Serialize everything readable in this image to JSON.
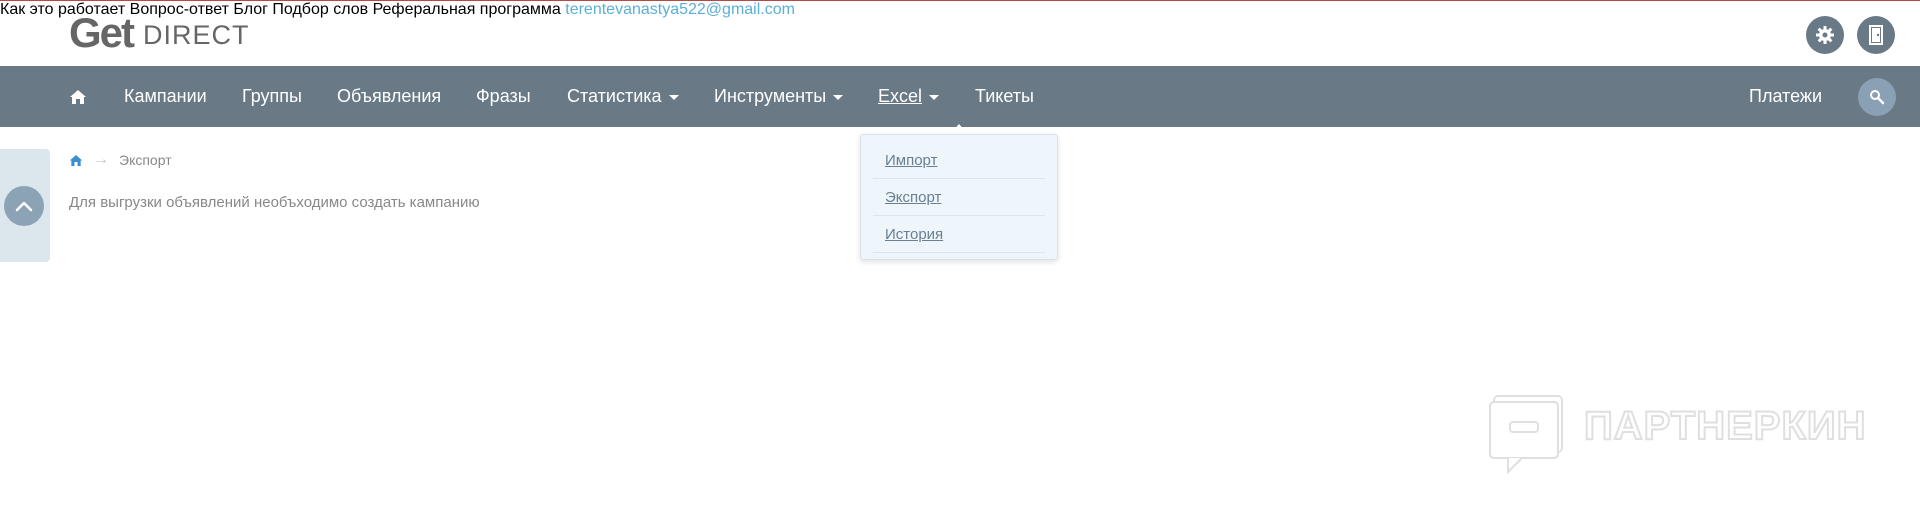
{
  "header": {
    "logo_get": "Get",
    "logo_direct": "DIRECT",
    "links": [
      "Как это работает",
      "Вопрос-ответ",
      "Блог",
      "Подбор слов",
      "Реферальная программа"
    ],
    "email": "terentevanastya522@gmail.com"
  },
  "mainnav": {
    "items": [
      "Кампании",
      "Группы",
      "Объявления",
      "Фразы",
      "Статистика",
      "Инструменты",
      "Excel",
      "Тикеты"
    ],
    "payments": "Платежи"
  },
  "dropdown": {
    "items": [
      "Импорт",
      "Экспорт",
      "История"
    ]
  },
  "breadcrumb": {
    "current": "Экспорт"
  },
  "content": {
    "message": "Для выгрузки объявлений необъходимо создать кампанию"
  },
  "watermark": {
    "text": "ПАРТНЕРКИН"
  },
  "colors": {
    "nav_bg": "#697985",
    "email": "#5bafd8",
    "dropdown_bg": "#eef5fb",
    "top_line": "#b24a4a"
  }
}
